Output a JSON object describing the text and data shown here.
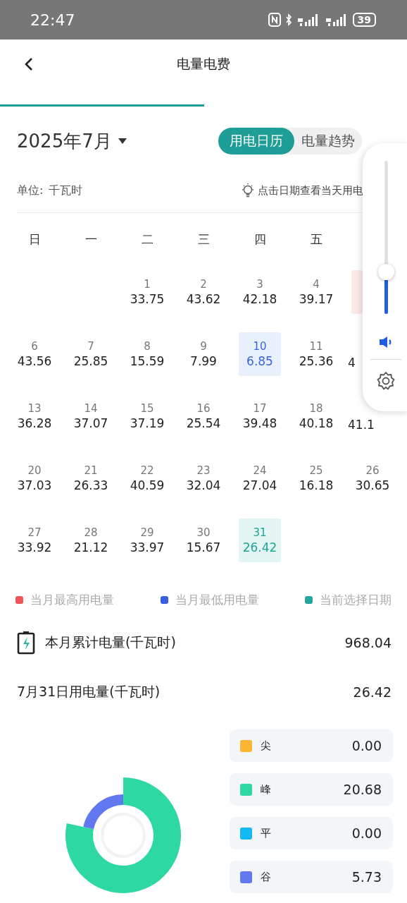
{
  "status_bar": {
    "time": "22:47",
    "battery": "39"
  },
  "header": {
    "title": "电量电费"
  },
  "month": {
    "label": "2025年7月"
  },
  "view_toggle": [
    {
      "label": "用电日历",
      "selected": true
    },
    {
      "label": "电量趋势",
      "selected": false
    }
  ],
  "unit": {
    "label": "单位:",
    "value": "千瓦时"
  },
  "hint": "点击日期查看当天用电",
  "weekdays": [
    "日",
    "一",
    "二",
    "三",
    "四",
    "五"
  ],
  "calendar": [
    [
      {
        "kind": "blank"
      },
      {
        "kind": "blank"
      },
      {
        "date": "1",
        "value": "33.75",
        "kind": "normal"
      },
      {
        "date": "2",
        "value": "43.62",
        "kind": "normal"
      },
      {
        "date": "3",
        "value": "42.18",
        "kind": "normal"
      },
      {
        "date": "4",
        "value": "39.17",
        "kind": "normal"
      },
      {
        "kind": "max"
      }
    ],
    [
      {
        "date": "6",
        "value": "43.56",
        "kind": "normal"
      },
      {
        "date": "7",
        "value": "25.85",
        "kind": "normal"
      },
      {
        "date": "8",
        "value": "15.59",
        "kind": "normal"
      },
      {
        "date": "9",
        "value": "7.99",
        "kind": "normal"
      },
      {
        "date": "10",
        "value": "6.85",
        "kind": "min"
      },
      {
        "date": "11",
        "value": "25.36",
        "kind": "normal"
      },
      {
        "value": "4",
        "kind": "normal"
      }
    ],
    [
      {
        "date": "13",
        "value": "36.28",
        "kind": "normal"
      },
      {
        "date": "14",
        "value": "37.07",
        "kind": "normal"
      },
      {
        "date": "15",
        "value": "37.19",
        "kind": "normal"
      },
      {
        "date": "16",
        "value": "25.54",
        "kind": "normal"
      },
      {
        "date": "17",
        "value": "39.48",
        "kind": "normal"
      },
      {
        "date": "18",
        "value": "40.18",
        "kind": "normal"
      },
      {
        "value": "41.1",
        "kind": "normal"
      }
    ],
    [
      {
        "date": "20",
        "value": "37.03",
        "kind": "normal"
      },
      {
        "date": "21",
        "value": "26.33",
        "kind": "normal"
      },
      {
        "date": "22",
        "value": "40.59",
        "kind": "normal"
      },
      {
        "date": "23",
        "value": "32.04",
        "kind": "normal"
      },
      {
        "date": "24",
        "value": "27.04",
        "kind": "normal"
      },
      {
        "date": "25",
        "value": "16.18",
        "kind": "normal"
      },
      {
        "date": "26",
        "value": "30.65",
        "kind": "normal"
      }
    ],
    [
      {
        "date": "27",
        "value": "33.92",
        "kind": "normal"
      },
      {
        "date": "28",
        "value": "21.12",
        "kind": "normal"
      },
      {
        "date": "29",
        "value": "33.97",
        "kind": "normal"
      },
      {
        "date": "30",
        "value": "15.67",
        "kind": "normal"
      },
      {
        "date": "31",
        "value": "26.42",
        "kind": "selected"
      }
    ]
  ],
  "legend": [
    {
      "label": "当月最高用电量",
      "color": "#f05454"
    },
    {
      "label": "当月最低用电量",
      "color": "#3a5fe0"
    },
    {
      "label": "当前选择日期",
      "color": "#26a69a"
    }
  ],
  "summary": [
    {
      "label": "本月累计电量(千瓦时)",
      "value": "968.04",
      "kind": "total"
    },
    {
      "label": "7月31日用电量(千瓦时)",
      "value": "26.42",
      "kind": "day"
    }
  ],
  "breakdown": {
    "items": [
      {
        "label": "尖",
        "value": "0.00",
        "color": "#ffb534"
      },
      {
        "label": "峰",
        "value": "20.68",
        "color": "#2ed8a3"
      },
      {
        "label": "平",
        "value": "0.00",
        "color": "#14b8f5"
      },
      {
        "label": "谷",
        "value": "5.73",
        "color": "#6178ee"
      }
    ]
  },
  "volume_panel": {
    "level": 0.27
  }
}
